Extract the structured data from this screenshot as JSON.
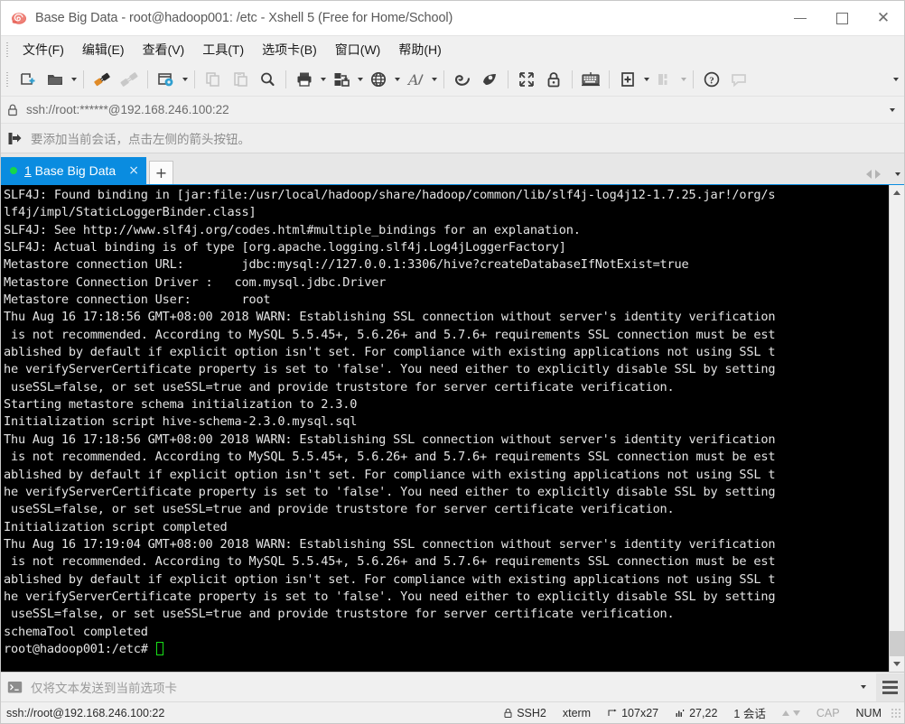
{
  "window": {
    "title": "Base Big Data - root@hadoop001: /etc - Xshell 5 (Free for Home/School)",
    "icon": "xshell-logo-icon",
    "minimize_label": "—",
    "maximize_label": "□",
    "close_label": "✕"
  },
  "menubar": {
    "items": [
      {
        "label": "文件(F)",
        "name": "menu-file"
      },
      {
        "label": "编辑(E)",
        "name": "menu-edit"
      },
      {
        "label": "查看(V)",
        "name": "menu-view"
      },
      {
        "label": "工具(T)",
        "name": "menu-tools"
      },
      {
        "label": "选项卡(B)",
        "name": "menu-tabs"
      },
      {
        "label": "窗口(W)",
        "name": "menu-window"
      },
      {
        "label": "帮助(H)",
        "name": "menu-help"
      }
    ]
  },
  "toolbar": {
    "buttons": [
      {
        "name": "new-session-icon",
        "title": "新建会话",
        "caret": false,
        "dim": false
      },
      {
        "name": "open-folder-icon",
        "title": "打开",
        "caret": true,
        "dim": false
      },
      {
        "name": "connect-icon",
        "title": "连接",
        "caret": false,
        "dim": false
      },
      {
        "name": "disconnect-icon",
        "title": "断开",
        "caret": false,
        "dim": true
      },
      {
        "name": "session-properties-icon",
        "title": "属性",
        "caret": true,
        "dim": false
      },
      {
        "name": "copy-icon",
        "title": "复制",
        "caret": false,
        "dim": true
      },
      {
        "name": "paste-icon",
        "title": "粘贴",
        "caret": false,
        "dim": true
      },
      {
        "name": "find-icon",
        "title": "查找",
        "caret": false,
        "dim": false
      },
      {
        "name": "print-icon",
        "title": "打印",
        "caret": true,
        "dim": false
      },
      {
        "name": "file-transfer-icon",
        "title": "传输",
        "caret": true,
        "dim": false
      },
      {
        "name": "globe-icon",
        "title": "浏览",
        "caret": true,
        "dim": false
      },
      {
        "name": "font-icon",
        "title": "字体",
        "caret": true,
        "dim": false
      },
      {
        "name": "xftp-icon",
        "title": "Xftp",
        "caret": false,
        "dim": false
      },
      {
        "name": "xagent-icon",
        "title": "Xagent",
        "caret": false,
        "dim": false
      },
      {
        "name": "fullscreen-icon",
        "title": "全屏",
        "caret": false,
        "dim": false
      },
      {
        "name": "lock-icon",
        "title": "锁定",
        "caret": false,
        "dim": false
      },
      {
        "name": "keyboard-icon",
        "title": "键盘",
        "caret": false,
        "dim": false
      },
      {
        "name": "add-tab-icon",
        "title": "新选项卡",
        "caret": true,
        "dim": false
      },
      {
        "name": "layout-icon",
        "title": "布局",
        "caret": true,
        "dim": true
      },
      {
        "name": "help-icon",
        "title": "帮助",
        "caret": false,
        "dim": false
      },
      {
        "name": "comment-icon",
        "title": "反馈",
        "caret": false,
        "dim": true
      }
    ],
    "overflow_label": "▼"
  },
  "address_bar": {
    "icon": "lock-icon",
    "value": "ssh://root:******@192.168.246.100:22",
    "dropdown": "chevron-down-icon"
  },
  "notice_bar": {
    "icon": "add-session-arrow-icon",
    "text": "要添加当前会话，点击左侧的箭头按钮。"
  },
  "tabs": {
    "items": [
      {
        "mnemonic": "1",
        "label": " Base Big Data",
        "status": "connected",
        "active": true,
        "close_label": "×"
      }
    ],
    "new_tab_label": "+",
    "scroll_left": "◀",
    "scroll_right": "▶",
    "list_label": "▼"
  },
  "terminal": {
    "background": "#000000",
    "foreground": "#e4e4e4",
    "cursor_color": "#18e018",
    "lines": [
      "SLF4J: Found binding in [jar:file:/usr/local/hadoop/share/hadoop/common/lib/slf4j-log4j12-1.7.25.jar!/org/s",
      "lf4j/impl/StaticLoggerBinder.class]",
      "SLF4J: See http://www.slf4j.org/codes.html#multiple_bindings for an explanation.",
      "SLF4J: Actual binding is of type [org.apache.logging.slf4j.Log4jLoggerFactory]",
      "Metastore connection URL:\t jdbc:mysql://127.0.0.1:3306/hive?createDatabaseIfNotExist=true",
      "Metastore Connection Driver :\tcom.mysql.jdbc.Driver",
      "Metastore connection User:\t root",
      "Thu Aug 16 17:18:56 GMT+08:00 2018 WARN: Establishing SSL connection without server's identity verification",
      " is not recommended. According to MySQL 5.5.45+, 5.6.26+ and 5.7.6+ requirements SSL connection must be est",
      "ablished by default if explicit option isn't set. For compliance with existing applications not using SSL t",
      "he verifyServerCertificate property is set to 'false'. You need either to explicitly disable SSL by setting",
      " useSSL=false, or set useSSL=true and provide truststore for server certificate verification.",
      "Starting metastore schema initialization to 2.3.0",
      "Initialization script hive-schema-2.3.0.mysql.sql",
      "Thu Aug 16 17:18:56 GMT+08:00 2018 WARN: Establishing SSL connection without server's identity verification",
      " is not recommended. According to MySQL 5.5.45+, 5.6.26+ and 5.7.6+ requirements SSL connection must be est",
      "ablished by default if explicit option isn't set. For compliance with existing applications not using SSL t",
      "he verifyServerCertificate property is set to 'false'. You need either to explicitly disable SSL by setting",
      " useSSL=false, or set useSSL=true and provide truststore for server certificate verification.",
      "Initialization script completed",
      "Thu Aug 16 17:19:04 GMT+08:00 2018 WARN: Establishing SSL connection without server's identity verification",
      " is not recommended. According to MySQL 5.5.45+, 5.6.26+ and 5.7.6+ requirements SSL connection must be est",
      "ablished by default if explicit option isn't set. For compliance with existing applications not using SSL t",
      "he verifyServerCertificate property is set to 'false'. You need either to explicitly disable SSL by setting",
      " useSSL=false, or set useSSL=true and provide truststore for server certificate verification.",
      "schemaTool completed"
    ],
    "prompt": "root@hadoop001:/etc#"
  },
  "send_bar": {
    "icon": "terminal-prompt-icon",
    "placeholder": "仅将文本发送到当前选项卡",
    "value": "",
    "dropdown": "chevron-down-icon",
    "menu_icon": "list-menu-icon"
  },
  "status_bar": {
    "connection": "ssh://root@192.168.246.100:22",
    "protocol": "SSH2",
    "protocol_icon": "lock-icon",
    "terminal_type": "xterm",
    "size": "107x27",
    "size_icon": "resize-icon",
    "cursor_position": "27,22",
    "cursor_icon": "cursor-pos-icon",
    "sessions": "1 会话",
    "caps_lock": "CAP",
    "num_lock": "NUM"
  }
}
